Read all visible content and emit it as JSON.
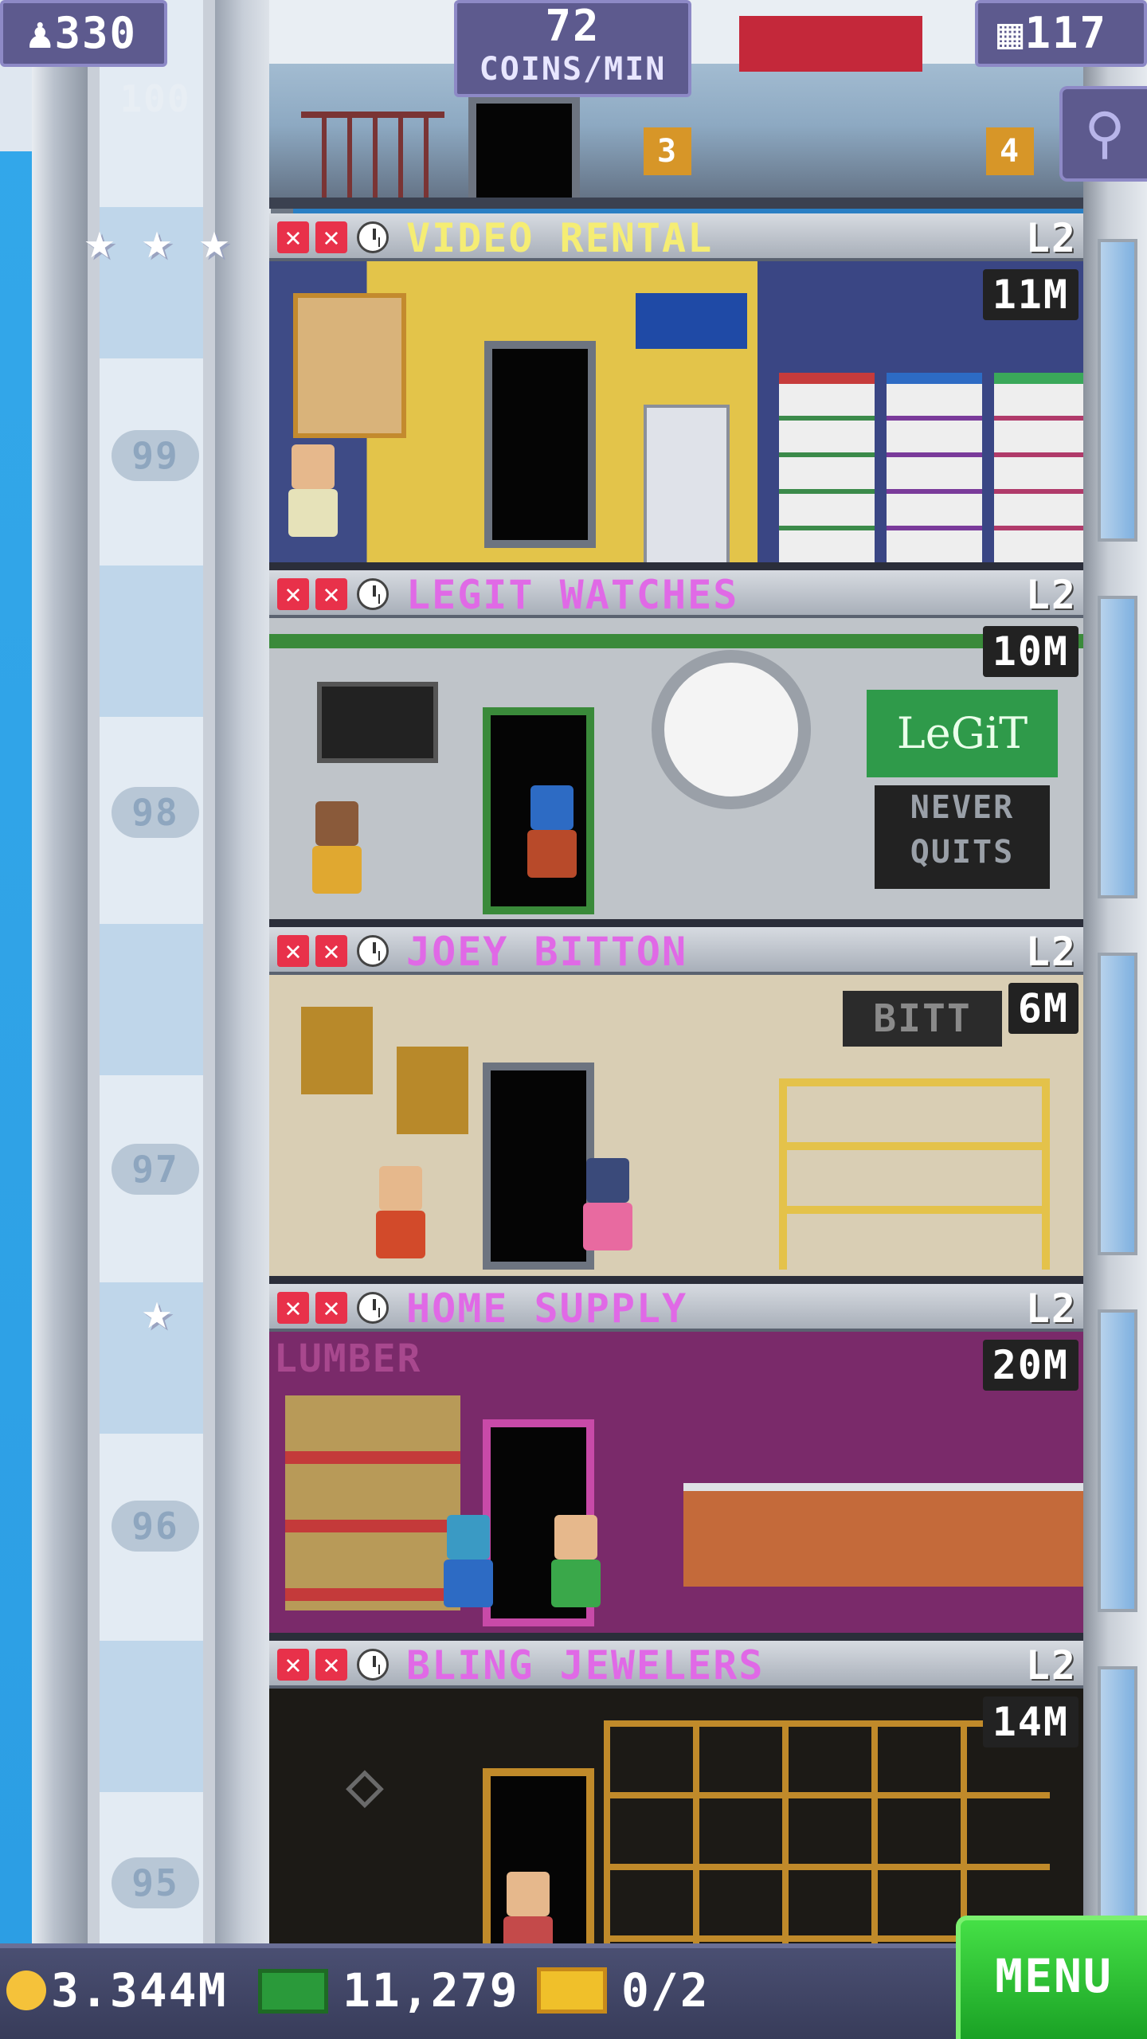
{
  "hud": {
    "population": "330",
    "coins_rate_value": "72",
    "coins_rate_unit": "COINS/MIN",
    "floors_count": "117"
  },
  "top_floor_number": "100",
  "floors": [
    {
      "name": "VIDEO RENTAL",
      "level": "L2",
      "income": "11M",
      "name_color": "#f5ed74",
      "floor_number": "99"
    },
    {
      "name": "LEGIT WATCHES",
      "level": "L2",
      "income": "10M",
      "name_color": "#e069e6",
      "floor_number": "98"
    },
    {
      "name": "JOEY BITTON",
      "level": "L2",
      "income": "6M",
      "name_color": "#e069e6",
      "floor_number": "97"
    },
    {
      "name": "HOME SUPPLY",
      "level": "L2",
      "income": "20M",
      "name_color": "#e069e6",
      "floor_number": "96"
    },
    {
      "name": "BLING JEWELERS",
      "level": "L2",
      "income": "14M",
      "name_color": "#e069e6",
      "floor_number": "95"
    }
  ],
  "room_signs": {
    "legit_logo": "LeGiT",
    "legit_slogan_line1": "NEVER",
    "legit_slogan_line2": "QUITS",
    "joey_sign": "BITT",
    "home_sign": "LUMBER",
    "top_room_sign_a": "3",
    "top_room_sign_b": "4"
  },
  "bottom": {
    "coins": "3.344M",
    "bux": "11,279",
    "tickets": "0/2",
    "menu_label": "MENU"
  },
  "colors": {
    "menu_green": "#2cc435",
    "name_pink": "#e069e6",
    "name_yellow": "#f5ed74"
  }
}
